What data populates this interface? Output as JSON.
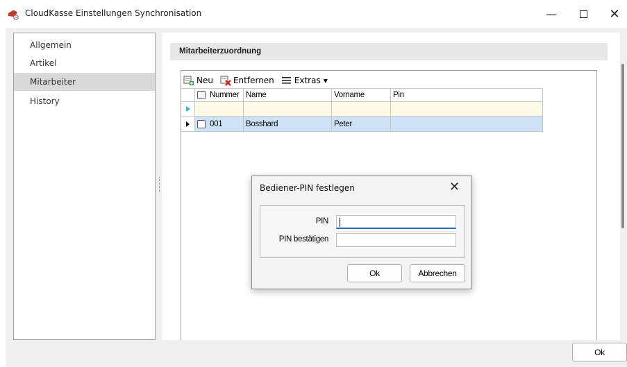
{
  "window": {
    "title": "CloudKasse Einstellungen Synchronisation",
    "icon": "cloudkasse-app-icon",
    "controls": [
      "minimize-icon",
      "maximize-icon",
      "close-icon"
    ]
  },
  "sidebar": {
    "items": [
      {
        "label": "Allgemein",
        "selected": false
      },
      {
        "label": "Artikel",
        "selected": false
      },
      {
        "label": "Mitarbeiter",
        "selected": true
      },
      {
        "label": "History",
        "selected": false
      }
    ]
  },
  "main": {
    "section_title": "Mitarbeiterzuordnung",
    "toolbar": {
      "new_label": "Neu",
      "remove_label": "Entfernen",
      "extras_label": "Extras"
    },
    "grid": {
      "columns": [
        "Nummer",
        "Name",
        "Vorname",
        "Pin"
      ],
      "rows": [
        {
          "number": "001",
          "name": "Bosshard",
          "firstname": "Peter",
          "pin": ""
        }
      ]
    },
    "ok_label": "Ok"
  },
  "dialog": {
    "title": "Bediener-PIN festlegen",
    "pin_label": "PIN",
    "pin_value": "",
    "confirm_label": "PIN bestätigen",
    "confirm_value": "",
    "ok_label": "Ok",
    "cancel_label": "Abbrechen"
  },
  "colors": {
    "selected_row": "#cde2f6",
    "new_row": "#fdfbe6",
    "sidebar_selected": "#d9d9d9",
    "focus_underline": "#1a6fc4",
    "new_row_indicator": "#2bb5d6"
  }
}
